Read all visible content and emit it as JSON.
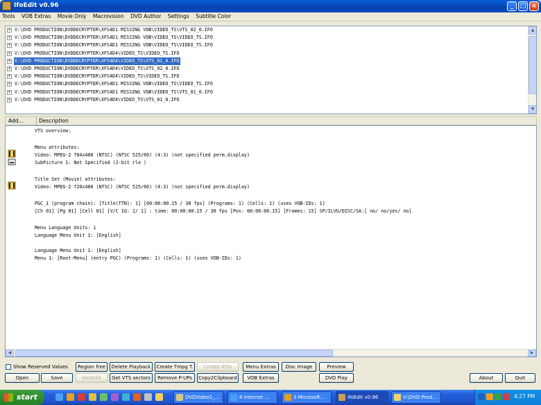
{
  "window": {
    "title": "IfoEdit v0.96",
    "buttons": {
      "minimize": "_",
      "maximize": "□",
      "close": "×"
    }
  },
  "menu": [
    "Tools",
    "VOB Extras",
    "Movie Only",
    "Macrovision",
    "DVD Author",
    "Settings",
    "Subtitle Color"
  ],
  "files": [
    {
      "path": "V:\\DVD PRODUCTION\\DVDDECRYPTER\\XFS4D1 MISSING VOB\\VIDEO_TS\\VTS_02_0.IFO",
      "selected": false
    },
    {
      "path": "V:\\DVD PRODUCTION\\DVDDECRYPTER\\XFS4D1 MISSING VOB\\VIDEO_TS\\VIDEO_TS.IFO",
      "selected": false
    },
    {
      "path": "V:\\DVD PRODUCTION\\DVDDECRYPTER\\XFS4D1 MISSING VOB\\VIDEO_TS\\VIDEO_TS.IFO",
      "selected": false
    },
    {
      "path": "V:\\DVD PRODUCTION\\DVDDECRYPTER\\XFS4D4\\VIDEO_TS\\VIDEO_TS.IFO",
      "selected": false
    },
    {
      "path": "V:\\DVD PRODUCTION\\DVDDECRYPTER\\XFS4D4\\VIDEO_TS\\VTS_01_0.IFO",
      "selected": true
    },
    {
      "path": "V:\\DVD PRODUCTION\\DVDDECRYPTER\\XFS4D4\\VIDEO_TS\\VTS_02_0.IFO",
      "selected": false
    },
    {
      "path": "V:\\DVD PRODUCTION\\DVDDECRYPTER\\XFS4D4\\VIDEO_TS\\VIDEO_TS.IFO",
      "selected": false
    },
    {
      "path": "V:\\DVD PRODUCTION\\DVDDECRYPTER\\XFS4D1 MISSING VOB\\VIDEO_TS\\VIDEO_TS.IFO",
      "selected": false
    },
    {
      "path": "V:\\DVD PRODUCTION\\DVDDECRYPTER\\XFS4D1 MISSING VOB\\VIDEO_TS\\VTS_01_0.IFO",
      "selected": false
    },
    {
      "path": "V:\\DVD PRODUCTION\\DVDDECRYPTER\\XFS4D4\\VIDEO_TS\\VTS_01_0.IFO",
      "selected": false
    }
  ],
  "detail_header": {
    "add": "Add...",
    "description": "Description"
  },
  "detail_lines": [
    "VTS overview:",
    "Menu attributes:",
    "  Video: MPEG-2 704x480 (NTSC) (NTSC 525/60) (4:3) (not specified perm.display)",
    "  SubPicture 1: Not Specified        (2-bit rle )",
    "Title Set (Movie) attributes:",
    "  Video: MPEG-2 720x480 (NTSC) (NTSC 525/60) (4:3) (not specified perm.display)",
    "PGC_1 (program chain): [Title(TTN): 1] [00:00:00.15 / 30 fps] (Programs: 1) (Cells: 1) (uses VOB-IDs: 1)",
    "  [Ch 01] [Pg 01] [Cell 01] [V/C Id:  1/ 1]          : time: 00:00:00.15 / 30 fps     [Pos: 00:00:00.15] [Frames: 15] SP/ILVU/DISC/SA:[ no/ no/yes/ no]",
    "Menu Language Units: 1",
    "  Language Menu Unit 1: [English]",
    "  Language Menu Unit 1: [English]",
    "    Menu 1: [Root-Menu]          (entry PGC) (Programs: 1) (Cells: 1) (uses VOB-IDs: 1)"
  ],
  "buttons": {
    "show_reserved": "Show Reserved Values",
    "open": "Open",
    "save": "Save",
    "region_free": "Region free",
    "hex_edit": "HexEdit",
    "delete_playback": "Delete Playback",
    "get_vts_sectors": "Get VTS sectors",
    "create_tmpg": "Create Tmpg T.",
    "remove_pups": "Remove P-UPs",
    "create_ifos": "Create IFOs",
    "copy2clipboard": "Copy2Clipboard",
    "menu_extras": "Menu Extras",
    "vob_extras": "VOB Extras",
    "disc_image": "Disc Image",
    "preview": "Preview",
    "dvd_play": "DVD Play",
    "about": "About",
    "quit": "Quit"
  },
  "taskbar": {
    "start": "start",
    "tasks": [
      "DVDVideo1_...",
      "8 Internet ...",
      "3 Microsoft...",
      "IfoEdit v0.96",
      "V:\\DVD Prod..."
    ],
    "active_task": 3,
    "clock": "4:27 PM"
  }
}
